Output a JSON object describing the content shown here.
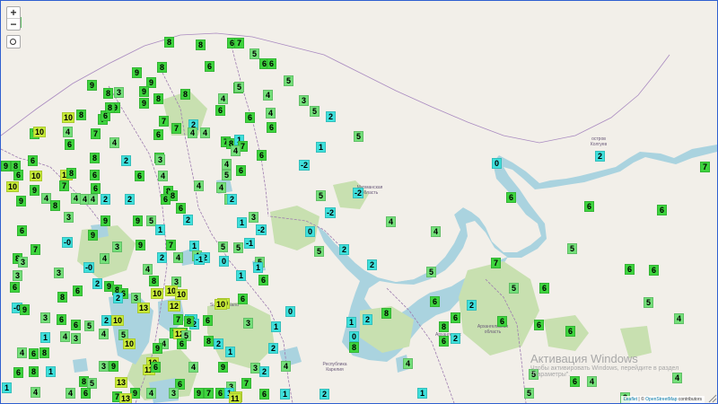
{
  "map": {
    "zoom_in": "+",
    "zoom_out": "−",
    "locate_icon": "locate-icon",
    "colors": {
      "sea": "#aad3df",
      "land": "#f2efe9",
      "forest": "#c8e0b0",
      "border": "#9e7cb0",
      "cold": "#3fe0dc",
      "cool": "#74e07a",
      "mild": "#3ed43e",
      "warm": "#c8ec38"
    },
    "labels": [
      "остров Колгуев",
      "Архангельская область",
      "Архангельск",
      "Мурманская область",
      "Республика Карелия",
      "Suomi Finland"
    ],
    "attribution": {
      "leaflet": "Leaflet",
      "sep": " | © ",
      "osm": "OpenStreetMap",
      "tail": " contributors"
    },
    "watermark": {
      "title": "Активация Windows",
      "subtitle": "Чтобы активировать Windows, перейдите в раздел \"Параметры\"."
    },
    "markers": [
      [
        "8",
        186,
        45
      ],
      [
        "8",
        221,
        48
      ],
      [
        "6",
        256,
        46
      ],
      [
        "7",
        264,
        46
      ],
      [
        "6",
        231,
        72
      ],
      [
        "5",
        281,
        58
      ],
      [
        "6",
        292,
        69
      ],
      [
        "6",
        300,
        69
      ],
      [
        "5",
        319,
        88
      ],
      [
        "8",
        13,
        12
      ],
      [
        "4",
        16,
        23
      ],
      [
        "9",
        100,
        93
      ],
      [
        "9",
        150,
        79
      ],
      [
        "8",
        178,
        73
      ],
      [
        "9",
        166,
        90
      ],
      [
        "9",
        118,
        102
      ],
      [
        "9",
        158,
        100
      ],
      [
        "8",
        118,
        102
      ],
      [
        "3",
        130,
        101
      ],
      [
        "9",
        158,
        113
      ],
      [
        "9",
        126,
        118
      ],
      [
        "8",
        174,
        108
      ],
      [
        "8",
        204,
        103
      ],
      [
        "6",
        263,
        96
      ],
      [
        "5",
        264,
        95
      ],
      [
        "4",
        246,
        108
      ],
      [
        "4",
        296,
        104
      ],
      [
        "3",
        336,
        110
      ],
      [
        "5",
        348,
        122
      ],
      [
        "2",
        366,
        128
      ],
      [
        "10",
        72,
        129
      ],
      [
        "8",
        88,
        126
      ],
      [
        "7",
        112,
        131
      ],
      [
        "6",
        115,
        127
      ],
      [
        "8",
        120,
        118
      ],
      [
        "6",
        243,
        121
      ],
      [
        "6",
        276,
        129
      ],
      [
        "4",
        299,
        124
      ],
      [
        "7",
        194,
        141
      ],
      [
        "2",
        213,
        137
      ],
      [
        "4",
        212,
        146
      ],
      [
        "4",
        226,
        146
      ],
      [
        "7",
        180,
        133
      ],
      [
        "7",
        36,
        147
      ],
      [
        "10",
        40,
        145
      ],
      [
        "4",
        73,
        145
      ],
      [
        "7",
        104,
        147
      ],
      [
        "6",
        174,
        148
      ],
      [
        "6",
        300,
        140
      ],
      [
        "5",
        397,
        150
      ],
      [
        "6",
        75,
        159
      ],
      [
        "4",
        125,
        157
      ],
      [
        "7",
        249,
        156
      ],
      [
        "8",
        255,
        158
      ],
      [
        "1",
        264,
        154
      ],
      [
        "7",
        268,
        161
      ],
      [
        "4",
        260,
        166
      ],
      [
        "1",
        355,
        162
      ],
      [
        "9",
        3,
        183
      ],
      [
        "8",
        15,
        183
      ],
      [
        "6",
        34,
        177
      ],
      [
        "8",
        103,
        174
      ],
      [
        "2",
        138,
        177
      ],
      [
        "6",
        175,
        174
      ],
      [
        "3",
        176,
        176
      ],
      [
        "4",
        250,
        181
      ],
      [
        "6",
        289,
        171
      ],
      [
        "6",
        18,
        193
      ],
      [
        "10",
        36,
        194
      ],
      [
        "10",
        70,
        193
      ],
      [
        "8",
        77,
        191
      ],
      [
        "6",
        103,
        193
      ],
      [
        "6",
        153,
        194
      ],
      [
        "4",
        179,
        194
      ],
      [
        "6",
        266,
        188
      ],
      [
        "5",
        250,
        193
      ],
      [
        "-2",
        336,
        182
      ],
      [
        "0",
        551,
        180
      ],
      [
        "10",
        10,
        206
      ],
      [
        "9",
        36,
        210
      ],
      [
        "7",
        69,
        205
      ],
      [
        "6",
        104,
        208
      ],
      [
        "8",
        185,
        211
      ],
      [
        "8",
        190,
        216
      ],
      [
        "4",
        219,
        205
      ],
      [
        "4",
        244,
        207
      ],
      [
        "9",
        21,
        222
      ],
      [
        "4",
        49,
        219
      ],
      [
        "4",
        82,
        219
      ],
      [
        "4",
        92,
        220
      ],
      [
        "4",
        101,
        220
      ],
      [
        "2",
        115,
        220
      ],
      [
        "2",
        142,
        220
      ],
      [
        "6",
        182,
        220
      ],
      [
        "5",
        253,
        220
      ],
      [
        "2",
        256,
        220
      ],
      [
        "5",
        355,
        216
      ],
      [
        "-2",
        396,
        213
      ],
      [
        "7",
        783,
        184
      ],
      [
        "6",
        567,
        218
      ],
      [
        "8",
        59,
        227
      ],
      [
        "6",
        199,
        230
      ],
      [
        "9",
        115,
        244
      ],
      [
        "9",
        151,
        244
      ],
      [
        "5",
        166,
        244
      ],
      [
        "3",
        74,
        240
      ],
      [
        "2",
        207,
        243
      ],
      [
        "1",
        267,
        246
      ],
      [
        "3",
        280,
        240
      ],
      [
        "-2",
        288,
        254
      ],
      [
        "-2",
        365,
        235
      ],
      [
        "4",
        433,
        245
      ],
      [
        "6",
        654,
        228
      ],
      [
        "6",
        735,
        232
      ],
      [
        "6",
        22,
        255
      ],
      [
        "9",
        101,
        260
      ],
      [
        "1",
        176,
        254
      ],
      [
        "0",
        343,
        256
      ],
      [
        "-1",
        275,
        269
      ],
      [
        "7",
        37,
        276
      ],
      [
        "9",
        154,
        271
      ],
      [
        "3",
        128,
        273
      ],
      [
        "7",
        188,
        271
      ],
      [
        "1",
        214,
        272
      ],
      [
        "5",
        246,
        273
      ],
      [
        "5",
        263,
        274
      ],
      [
        "5",
        353,
        278
      ],
      [
        "2",
        381,
        276
      ],
      [
        "4",
        483,
        256
      ],
      [
        "-0",
        72,
        268
      ],
      [
        "5",
        635,
        275
      ],
      [
        "8",
        17,
        286
      ],
      [
        "3",
        23,
        290
      ],
      [
        "4",
        114,
        286
      ],
      [
        "2",
        178,
        285
      ],
      [
        "4",
        196,
        285
      ],
      [
        "4",
        217,
        283
      ],
      [
        "2",
        226,
        285
      ],
      [
        "-1",
        219,
        287
      ],
      [
        "0",
        247,
        289
      ],
      [
        "5",
        287,
        290
      ],
      [
        "1",
        285,
        296
      ],
      [
        "2",
        412,
        293
      ],
      [
        "5",
        478,
        301
      ],
      [
        "7",
        550,
        291
      ],
      [
        "-0",
        96,
        296
      ],
      [
        "4",
        162,
        298
      ],
      [
        "3",
        17,
        305
      ],
      [
        "1",
        266,
        305
      ],
      [
        "2",
        106,
        314
      ],
      [
        "8",
        169,
        311
      ],
      [
        "9",
        119,
        317
      ],
      [
        "8",
        128,
        321
      ],
      [
        "3",
        63,
        302
      ],
      [
        "6",
        84,
        322
      ],
      [
        "6",
        14,
        318
      ],
      [
        "3",
        194,
        312
      ],
      [
        "6",
        291,
        310
      ],
      [
        "6",
        604,
        319
      ],
      [
        "5",
        570,
        319
      ],
      [
        "8",
        67,
        329
      ],
      [
        "6",
        135,
        325
      ],
      [
        "10",
        171,
        325
      ],
      [
        "10",
        187,
        322
      ],
      [
        "10",
        198,
        326
      ],
      [
        "3",
        149,
        330
      ],
      [
        "2",
        129,
        330
      ],
      [
        "6",
        268,
        331
      ],
      [
        "10",
        245,
        336
      ],
      [
        "10",
        242,
        337
      ],
      [
        "6",
        482,
        334
      ],
      [
        "2",
        523,
        338
      ],
      [
        "6",
        699,
        298
      ],
      [
        "6",
        726,
        299
      ],
      [
        "-0",
        16,
        341
      ],
      [
        "9",
        25,
        343
      ],
      [
        "12",
        190,
        339
      ],
      [
        "3",
        48,
        352
      ],
      [
        "6",
        66,
        354
      ],
      [
        "6",
        82,
        360
      ],
      [
        "0",
        321,
        345
      ],
      [
        "7",
        196,
        354
      ],
      [
        "1",
        209,
        354
      ],
      [
        "6",
        229,
        355
      ],
      [
        "2",
        116,
        355
      ],
      [
        "10",
        127,
        355
      ],
      [
        "13",
        156,
        341
      ],
      [
        "5",
        720,
        335
      ],
      [
        "1",
        389,
        357
      ],
      [
        "2",
        407,
        354
      ],
      [
        "8",
        428,
        347
      ],
      [
        "6",
        505,
        352
      ],
      [
        "6",
        557,
        356
      ],
      [
        "6",
        598,
        360
      ],
      [
        "4",
        754,
        353
      ],
      [
        "5",
        97,
        361
      ],
      [
        "4",
        113,
        370
      ],
      [
        "7",
        192,
        369
      ],
      [
        "9",
        201,
        369
      ],
      [
        "12",
        209,
        356
      ],
      [
        "2",
        212,
        354
      ],
      [
        "2",
        214,
        359
      ],
      [
        "8",
        492,
        362
      ],
      [
        "6",
        633,
        367
      ],
      [
        "4",
        70,
        373
      ],
      [
        "1",
        48,
        374
      ],
      [
        "3",
        82,
        375
      ],
      [
        "5",
        135,
        371
      ],
      [
        "3",
        274,
        358
      ],
      [
        "1",
        305,
        362
      ],
      [
        "12",
        196,
        370
      ],
      [
        "5",
        205,
        372
      ],
      [
        "4",
        180,
        381
      ],
      [
        "10",
        140,
        381
      ],
      [
        "2",
        241,
        381
      ],
      [
        "6",
        492,
        378
      ],
      [
        "2",
        505,
        375
      ],
      [
        "8",
        230,
        378
      ],
      [
        "0",
        392,
        373
      ],
      [
        "8",
        392,
        385
      ],
      [
        "4",
        22,
        391
      ],
      [
        "6",
        35,
        392
      ],
      [
        "8",
        47,
        391
      ],
      [
        "9",
        173,
        386
      ],
      [
        "6",
        200,
        381
      ],
      [
        "10",
        166,
        402
      ],
      [
        "1",
        254,
        390
      ],
      [
        "2",
        302,
        386
      ],
      [
        "3",
        113,
        406
      ],
      [
        "9",
        124,
        406
      ],
      [
        "11",
        162,
        410
      ],
      [
        "6",
        171,
        407
      ],
      [
        "4",
        213,
        407
      ],
      [
        "9",
        246,
        407
      ],
      [
        "3",
        282,
        408
      ],
      [
        "2",
        292,
        412
      ],
      [
        "4",
        316,
        406
      ],
      [
        "4",
        452,
        403
      ],
      [
        "5",
        592,
        415
      ],
      [
        "4",
        752,
        419
      ],
      [
        "6",
        18,
        413
      ],
      [
        "8",
        35,
        412
      ],
      [
        "1",
        54,
        412
      ],
      [
        "8",
        91,
        423
      ],
      [
        "5",
        100,
        425
      ],
      [
        "13",
        131,
        424
      ],
      [
        "6",
        198,
        426
      ],
      [
        "7",
        272,
        425
      ],
      [
        "3",
        255,
        429
      ],
      [
        "6",
        638,
        423
      ],
      [
        "4",
        657,
        423
      ],
      [
        "1",
        5,
        430
      ],
      [
        "4",
        37,
        435
      ],
      [
        "4",
        76,
        436
      ],
      [
        "6",
        93,
        436
      ],
      [
        "9",
        148,
        436
      ],
      [
        "4",
        166,
        436
      ],
      [
        "3",
        191,
        436
      ],
      [
        "9",
        219,
        436
      ],
      [
        "7",
        230,
        436
      ],
      [
        "6",
        243,
        436
      ],
      [
        "1",
        253,
        436
      ],
      [
        "12",
        259,
        440
      ],
      [
        "11",
        258,
        445
      ],
      [
        "1",
        468,
        436
      ],
      [
        "5",
        587,
        436
      ],
      [
        "3",
        694,
        441
      ],
      [
        "7",
        128,
        440
      ],
      [
        "13",
        136,
        443
      ],
      [
        "1",
        315,
        437
      ],
      [
        "2",
        359,
        437
      ],
      [
        "6",
        292,
        437
      ],
      [
        "8",
        208,
        356
      ],
      [
        "2",
        666,
        172
      ]
    ]
  }
}
